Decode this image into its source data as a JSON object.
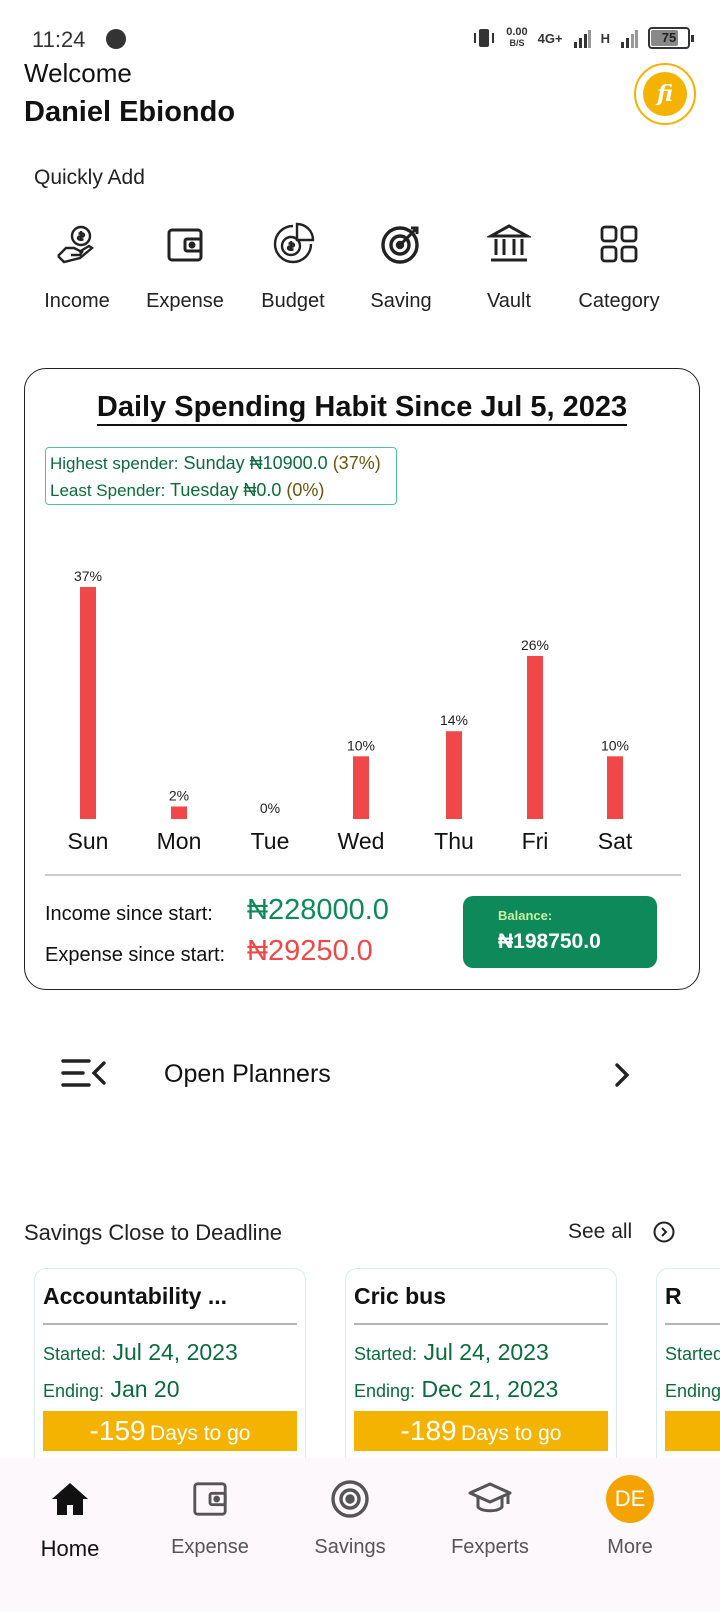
{
  "status_bar": {
    "time": "11:24",
    "net_speed_value": "0.00",
    "net_speed_unit": "B/S",
    "network_1": "4G+",
    "network_2": "H",
    "battery": "75"
  },
  "header": {
    "welcome": "Welcome",
    "username": "Daniel Ebiondo",
    "logo_text": "fi"
  },
  "quick_add": {
    "title": "Quickly Add",
    "items": [
      {
        "label": "Income",
        "icon": "money-hand-icon"
      },
      {
        "label": "Expense",
        "icon": "wallet-icon"
      },
      {
        "label": "Budget",
        "icon": "budget-pie-icon"
      },
      {
        "label": "Saving",
        "icon": "target-icon"
      },
      {
        "label": "Vault",
        "icon": "bank-icon"
      },
      {
        "label": "Category",
        "icon": "grid-icon"
      }
    ]
  },
  "spending": {
    "title": "Daily Spending Habit Since Jul 5, 2023",
    "highest_label": "Highest spender:",
    "highest_value": "Sunday ₦10900.0",
    "highest_pct": "(37%)",
    "least_label": "Least Spender:",
    "least_value": "Tuesday ₦0.0",
    "least_pct": "(0%)",
    "income_label": "Income since start:",
    "income_value": "₦228000.0",
    "expense_label": "Expense since start:",
    "expense_value": "₦29250.0",
    "balance_label": "Balance:",
    "balance_value": "₦198750.0"
  },
  "chart_data": {
    "type": "bar",
    "title": "Daily Spending Habit Since Jul 5, 2023",
    "categories": [
      "Sun",
      "Mon",
      "Tue",
      "Wed",
      "Thu",
      "Fri",
      "Sat"
    ],
    "values": [
      37,
      2,
      0,
      10,
      14,
      26,
      10
    ],
    "value_labels": [
      "37%",
      "2%",
      "0%",
      "10%",
      "14%",
      "26%",
      "10%"
    ],
    "ylim": [
      0,
      37
    ],
    "bar_color": "#f04848",
    "grid": false
  },
  "planners": {
    "label": "Open Planners"
  },
  "savings": {
    "title": "Savings Close to Deadline",
    "see_all": "See all",
    "started_label": "Started:",
    "ending_label": "Ending:",
    "days_suffix": "Days to go",
    "cards": [
      {
        "name": "Accountability ...",
        "started": "Jul 24, 2023",
        "ending": "Jan 20",
        "days": "-159"
      },
      {
        "name": "Cric bus",
        "started": "Jul 24, 2023",
        "ending": "Dec 21, 2023",
        "days": "-189"
      },
      {
        "name": "R",
        "started": "",
        "ending": "",
        "days": ""
      }
    ]
  },
  "bottom_nav": {
    "items": [
      {
        "label": "Home",
        "icon": "home-icon"
      },
      {
        "label": "Expense",
        "icon": "wallet-icon"
      },
      {
        "label": "Savings",
        "icon": "target-icon"
      },
      {
        "label": "Fexperts",
        "icon": "graduation-cap-icon"
      },
      {
        "label": "More",
        "icon": "avatar"
      }
    ],
    "avatar_initials": "DE"
  },
  "colors": {
    "green": "#0e8a5a",
    "red": "#f04848",
    "yellow": "#f5b301"
  }
}
